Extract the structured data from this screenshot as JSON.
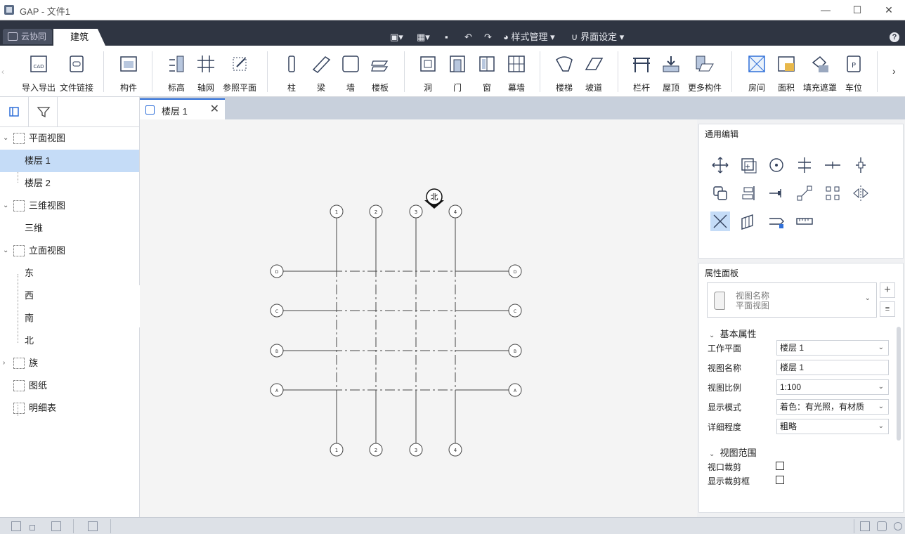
{
  "titlebar": {
    "title": "GAP - 文件1",
    "minimize": "—",
    "maximize": "☐",
    "close": "✕"
  },
  "menubar": {
    "tabs": [
      {
        "label": "云协同"
      },
      {
        "label": "建筑"
      }
    ],
    "quick_access": {
      "style_manage": "样式管理",
      "ui_settings": "界面设定"
    },
    "help": "?"
  },
  "ribbon": {
    "buttons": [
      {
        "label": "导入导出",
        "icon": "cad-import-icon"
      },
      {
        "label": "文件链接",
        "icon": "file-link-icon"
      },
      {
        "label": "构件",
        "icon": "component-icon"
      },
      {
        "label": "标高",
        "icon": "level-icon"
      },
      {
        "label": "轴网",
        "icon": "axis-grid-icon"
      },
      {
        "label": "参照平面",
        "icon": "reference-plane-icon"
      },
      {
        "label": "柱",
        "icon": "column-icon"
      },
      {
        "label": "梁",
        "icon": "beam-icon"
      },
      {
        "label": "墙",
        "icon": "wall-icon"
      },
      {
        "label": "楼板",
        "icon": "slab-icon"
      },
      {
        "label": "洞",
        "icon": "opening-icon"
      },
      {
        "label": "门",
        "icon": "door-icon"
      },
      {
        "label": "窗",
        "icon": "window-icon"
      },
      {
        "label": "幕墙",
        "icon": "curtain-wall-icon"
      },
      {
        "label": "楼梯",
        "icon": "stairs-icon"
      },
      {
        "label": "坡道",
        "icon": "ramp-icon"
      },
      {
        "label": "栏杆",
        "icon": "railing-icon"
      },
      {
        "label": "屋顶",
        "icon": "roof-icon"
      },
      {
        "label": "更多构件",
        "icon": "more-components-icon"
      },
      {
        "label": "房间",
        "icon": "room-icon"
      },
      {
        "label": "面积",
        "icon": "area-icon"
      },
      {
        "label": "填充遮罩",
        "icon": "fill-mask-icon"
      },
      {
        "label": "车位",
        "icon": "parking-icon"
      }
    ],
    "scroll_right": "›"
  },
  "project_tree": {
    "items": [
      {
        "label": "平面视图",
        "level": 0,
        "expanded": true
      },
      {
        "label": "楼层 1",
        "level": 1,
        "selected": true
      },
      {
        "label": "楼层 2",
        "level": 1
      },
      {
        "label": "三维视图",
        "level": 0,
        "expanded": true
      },
      {
        "label": "三维",
        "level": 1
      },
      {
        "label": "立面视图",
        "level": 0,
        "expanded": true
      },
      {
        "label": "东",
        "level": 1
      },
      {
        "label": "西",
        "level": 1
      },
      {
        "label": "南",
        "level": 1
      },
      {
        "label": "北",
        "level": 1
      },
      {
        "label": "族",
        "level": 0,
        "expanded": false
      },
      {
        "label": "图纸",
        "level": 0
      },
      {
        "label": "明细表",
        "level": 0
      }
    ]
  },
  "document_tab": {
    "label": "楼层 1"
  },
  "canvas": {
    "north_label": "北",
    "vertical_axes": [
      "1",
      "2",
      "3",
      "4"
    ],
    "horizontal_axes": [
      "D",
      "C",
      "B",
      "A"
    ]
  },
  "edit_panel": {
    "title": "通用编辑",
    "tools": [
      "move-icon",
      "copy-icon",
      "rotate-icon",
      "align-icon",
      "split-icon",
      "offset-icon",
      "duplicate-icon",
      "array-icon",
      "trim-icon",
      "scale-icon",
      "pattern-icon",
      "mirror-icon",
      "delete-icon",
      "extend-icon",
      "attach-icon",
      "measure-icon"
    ]
  },
  "properties": {
    "title": "属性面板",
    "type_selector": {
      "line1": "视图名称",
      "line2": "平面视图"
    },
    "add_button": "+",
    "basic_section": "基本属性",
    "rows": [
      {
        "label": "工作平面",
        "value": "楼层 1",
        "dropdown": true
      },
      {
        "label": "视图名称",
        "value": "楼层 1",
        "dropdown": false
      },
      {
        "label": "视图比例",
        "value": "1:100",
        "dropdown": true
      },
      {
        "label": "显示模式",
        "value": "着色：有光照，有材质",
        "dropdown": true
      },
      {
        "label": "详细程度",
        "value": "粗略",
        "dropdown": true
      }
    ],
    "range_section": "视图范围",
    "checks": [
      {
        "label": "视口裁剪",
        "checked": false
      },
      {
        "label": "显示裁剪框",
        "checked": false
      }
    ]
  }
}
